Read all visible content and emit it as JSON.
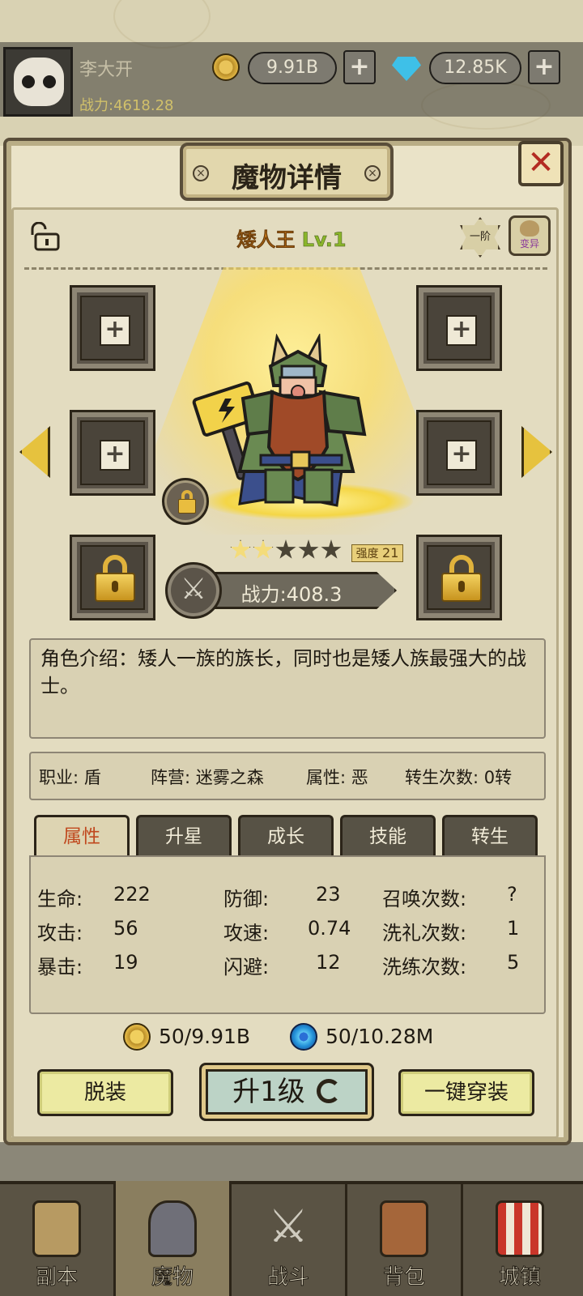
{
  "player": {
    "name": "李大开",
    "power": "战力:4618.28",
    "gold": "9.91B",
    "gems": "12.85K"
  },
  "dialog": {
    "title": "魔物详情",
    "close": "✕"
  },
  "monster": {
    "name": "矮人王",
    "level": "Lv.1",
    "tier": "一阶",
    "mutate_label": "变异",
    "stars_total": 5,
    "stars_filled": 2,
    "strength_label": "强度",
    "strength_value": "21",
    "power": "战力:408.3",
    "description": "角色介绍：矮人一族的族长，同时也是矮人族最强大的战士。"
  },
  "info": {
    "job": "职业: 盾",
    "camp": "阵营: 迷雾之森",
    "attr": "属性: 恶",
    "rebirth": "转生次数: 0转"
  },
  "tabs": [
    "属性",
    "升星",
    "成长",
    "技能",
    "转生"
  ],
  "stats": {
    "col1": [
      {
        "label": "生命:",
        "value": "222"
      },
      {
        "label": "攻击:",
        "value": "56"
      },
      {
        "label": "暴击:",
        "value": "19"
      }
    ],
    "col2": [
      {
        "label": "防御:",
        "value": "23"
      },
      {
        "label": "攻速:",
        "value": "0.74"
      },
      {
        "label": "闪避:",
        "value": "12"
      }
    ],
    "col3": [
      {
        "label": "召唤次数:",
        "value": "?"
      },
      {
        "label": "洗礼次数:",
        "value": "1"
      },
      {
        "label": "洗练次数:",
        "value": "5"
      }
    ]
  },
  "cost": {
    "gold": "50/9.91B",
    "essence": "50/10.28M"
  },
  "buttons": {
    "unequip": "脱装",
    "level_up": "升1级",
    "auto_equip": "一键穿装"
  },
  "nav": [
    "副本",
    "魔物",
    "战斗",
    "背包",
    "城镇"
  ],
  "colors": {
    "name_orange": "#d9831c",
    "level_green": "#8ab52a",
    "active_tab_text": "#c0481e",
    "close_red": "#b32b22"
  }
}
